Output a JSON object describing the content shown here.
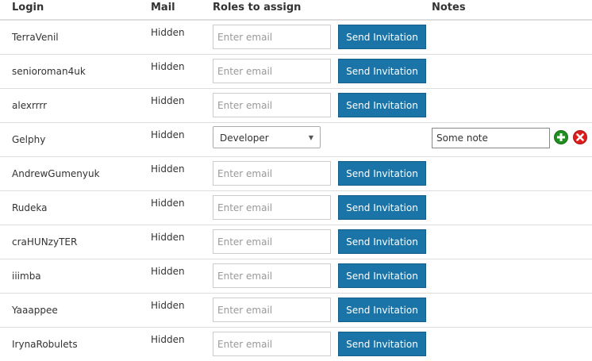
{
  "header": {
    "login": "Login",
    "mail": "Mail",
    "roles": "Roles to assign",
    "notes": "Notes"
  },
  "rows": [
    {
      "login": "TerraVenil",
      "mail": "Hidden"
    },
    {
      "login": "senioroman4uk",
      "mail": "Hidden"
    },
    {
      "login": "alexrrrr",
      "mail": "Hidden"
    },
    {
      "login": "Gelphy",
      "mail": "Hidden",
      "role": "Developer",
      "note": "Some note"
    },
    {
      "login": "AndrewGumenyuk",
      "mail": "Hidden"
    },
    {
      "login": "Rudeka",
      "mail": "Hidden"
    },
    {
      "login": "craHUNzyTER",
      "mail": "Hidden"
    },
    {
      "login": "iiimba",
      "mail": "Hidden"
    },
    {
      "login": "Yaaappee",
      "mail": "Hidden"
    },
    {
      "login": "IrynaRobulets",
      "mail": "Hidden"
    }
  ],
  "email_placeholder": "Enter email",
  "send_label": "Send Invitation",
  "colors": {
    "button": "#1a74a8",
    "add_icon": "#1f8f1f",
    "remove_icon": "#e01b1b"
  },
  "icons": {
    "add": "plus-circle-icon",
    "remove": "x-circle-icon",
    "dropdown": "chevron-down-icon"
  }
}
